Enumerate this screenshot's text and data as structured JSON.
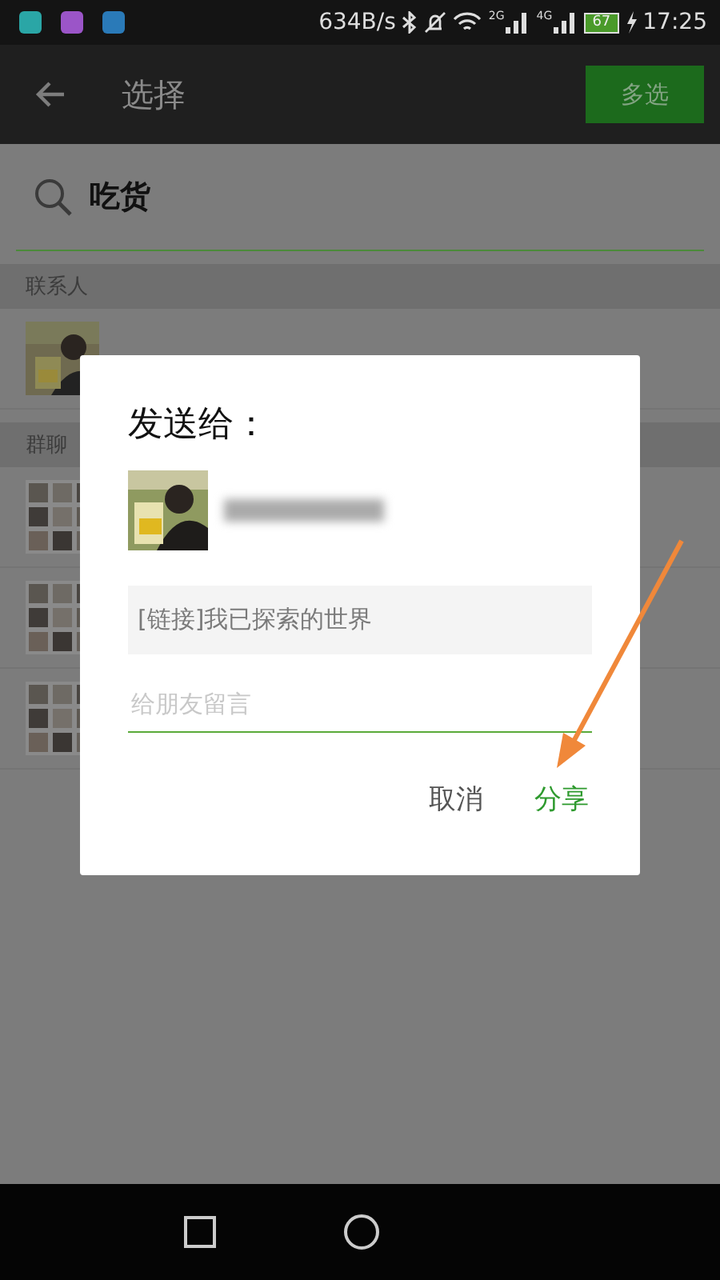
{
  "status_bar": {
    "speed": "634B/s",
    "signal_labels": [
      "2G",
      "4G"
    ],
    "battery": "67",
    "time": "17:25"
  },
  "app_bar": {
    "title": "选择",
    "action": "多选"
  },
  "search": {
    "value": "吃货"
  },
  "sections": [
    {
      "header": "联系人",
      "rows": [
        {
          "kind": "contact"
        }
      ]
    },
    {
      "header": "群聊",
      "rows": [
        {
          "kind": "group"
        },
        {
          "kind": "group"
        },
        {
          "kind": "group"
        }
      ]
    }
  ],
  "dialog": {
    "title": "发送给：",
    "link_text": "[链接]我已探索的世界",
    "message_placeholder": "给朋友留言",
    "buttons": [
      {
        "label": "取消",
        "kind": "cancel"
      },
      {
        "label": "分享",
        "kind": "primary"
      }
    ]
  }
}
